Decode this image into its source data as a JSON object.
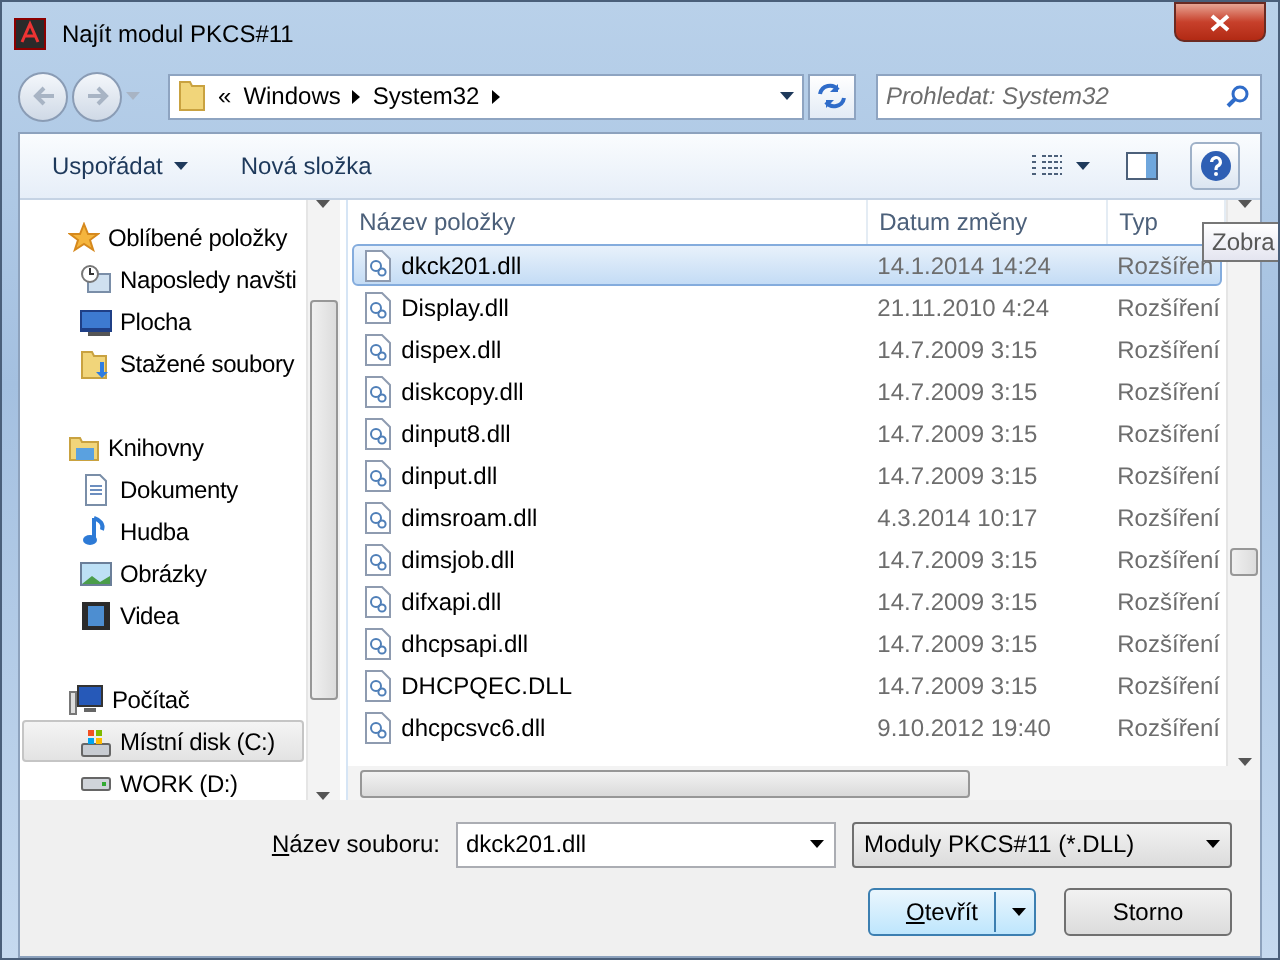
{
  "window": {
    "title": "Najít modul PKCS#11"
  },
  "address": {
    "overflow_marker": "«",
    "path": [
      "Windows",
      "System32"
    ]
  },
  "search": {
    "placeholder": "Prohledat: System32"
  },
  "toolbar": {
    "organize": "Uspořádat",
    "new_folder": "Nová složka"
  },
  "sidebar": {
    "groups": [
      {
        "label": "Oblíbené položky",
        "children": [
          {
            "label": "Naposledy navšti",
            "selected": false
          },
          {
            "label": "Plocha",
            "selected": false
          },
          {
            "label": "Stažené soubory",
            "selected": false
          }
        ]
      },
      {
        "label": "Knihovny",
        "children": [
          {
            "label": "Dokumenty",
            "selected": false
          },
          {
            "label": "Hudba",
            "selected": false
          },
          {
            "label": "Obrázky",
            "selected": false
          },
          {
            "label": "Videa",
            "selected": false
          }
        ]
      },
      {
        "label": "Počítač",
        "children": [
          {
            "label": "Místní disk (C:)",
            "selected": true
          },
          {
            "label": "WORK (D:)",
            "selected": false
          }
        ]
      }
    ]
  },
  "table": {
    "columns": [
      "Název položky",
      "Datum změny",
      "Typ"
    ],
    "rows": [
      {
        "name": "dkck201.dll",
        "date": "14.1.2014 14:24",
        "type": "Rozšířen",
        "selected": true
      },
      {
        "name": "Display.dll",
        "date": "21.11.2010 4:24",
        "type": "Rozšíření",
        "selected": false
      },
      {
        "name": "dispex.dll",
        "date": "14.7.2009 3:15",
        "type": "Rozšíření",
        "selected": false
      },
      {
        "name": "diskcopy.dll",
        "date": "14.7.2009 3:15",
        "type": "Rozšíření",
        "selected": false
      },
      {
        "name": "dinput8.dll",
        "date": "14.7.2009 3:15",
        "type": "Rozšíření",
        "selected": false
      },
      {
        "name": "dinput.dll",
        "date": "14.7.2009 3:15",
        "type": "Rozšíření",
        "selected": false
      },
      {
        "name": "dimsroam.dll",
        "date": "4.3.2014 10:17",
        "type": "Rozšíření",
        "selected": false
      },
      {
        "name": "dimsjob.dll",
        "date": "14.7.2009 3:15",
        "type": "Rozšíření",
        "selected": false
      },
      {
        "name": "difxapi.dll",
        "date": "14.7.2009 3:15",
        "type": "Rozšíření",
        "selected": false
      },
      {
        "name": "dhcpsapi.dll",
        "date": "14.7.2009 3:15",
        "type": "Rozšíření",
        "selected": false
      },
      {
        "name": "DHCPQEC.DLL",
        "date": "14.7.2009 3:15",
        "type": "Rozšíření",
        "selected": false
      },
      {
        "name": "dhcpcsvc6.dll",
        "date": "9.10.2012 19:40",
        "type": "Rozšíření",
        "selected": false
      }
    ]
  },
  "tooltip": {
    "text": "Zobra"
  },
  "file_name": {
    "label": "Název souboru:",
    "value": "dkck201.dll"
  },
  "file_filter": {
    "value": "Moduly PKCS#11 (*.DLL)"
  },
  "buttons": [
    {
      "label": "Otevřít",
      "kind": "split"
    },
    {
      "label": "Storno",
      "kind": "plain"
    }
  ]
}
